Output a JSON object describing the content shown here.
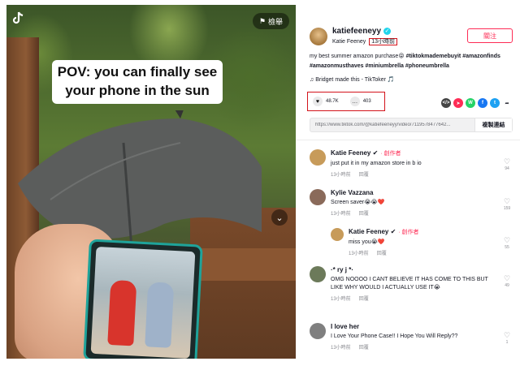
{
  "video": {
    "caption_line1": "POV: you can finally see",
    "caption_line2": "your phone in the sun",
    "report_label": "檢舉",
    "logo_icon": "tiktok-logo-icon",
    "flag_icon": "flag-icon",
    "next_icon": "chevron-down-icon"
  },
  "author": {
    "username": "katiefeeneyy",
    "nickname": "Katie Feeney",
    "post_time": "13小時前",
    "follow_label": "關注",
    "verified": true
  },
  "description": {
    "text": "my best summer amazon purchase😝 ",
    "tags": "#tiktokmademebuyit #amazonfinds #amazonmusthaves #miniumbrella #phoneumbrella"
  },
  "music": "♫  Bridget made this - TikToker 🎵",
  "stats": {
    "likes": "48.7K",
    "comments": "403"
  },
  "share_icons": [
    {
      "name": "embed-icon",
      "color": "#454545",
      "glyph": "</>"
    },
    {
      "name": "send-icon",
      "color": "#fe2c55",
      "glyph": "➤"
    },
    {
      "name": "whatsapp-icon",
      "color": "#25d366",
      "glyph": "W"
    },
    {
      "name": "facebook-icon",
      "color": "#1877f2",
      "glyph": "f"
    },
    {
      "name": "twitter-icon",
      "color": "#1da1f2",
      "glyph": "t"
    },
    {
      "name": "share-icon",
      "color": "#161823",
      "glyph": "➦"
    }
  ],
  "link": {
    "url": "https://www.tiktok.com/@katiefeeneyy/video/7119578477642...",
    "copy_label": "複製連結"
  },
  "comments": [
    {
      "name": "Katie Feeney ✔",
      "creator": "· 創作者",
      "text": "just put it in my amazon store in b io",
      "time": "13小時前",
      "reply": "回覆",
      "likes": "94",
      "avatar_color": "#c79b5a"
    },
    {
      "name": "Kylie Vazzana",
      "creator": "",
      "text": "Screen saver😭😭❤️",
      "time": "13小時前",
      "reply": "回覆",
      "likes": "159",
      "avatar_color": "#8a6a5a"
    },
    {
      "name": "Katie Feeney ✔",
      "creator": "· 創作者",
      "text": "miss you😭❤️",
      "time": "13小時前",
      "reply": "回覆",
      "likes": "55",
      "avatar_color": "#c79b5a"
    },
    {
      "name": "·* ry j *·",
      "creator": "",
      "text": "OMG NOOOO I CANT BELIEVE IT HAS COME TO THIS BUT LIKE WHY WOULD I ACTUALLY USE IT😭",
      "time": "13小時前",
      "reply": "回覆",
      "likes": "49",
      "avatar_color": "#6c7a5a"
    },
    {
      "name": "I love her",
      "creator": "",
      "text": "I Love Your Phone Case!! I Hope You Will Reply??",
      "time": "13小時前",
      "reply": "回覆",
      "likes": "1",
      "avatar_color": "#7f7f7f"
    }
  ]
}
